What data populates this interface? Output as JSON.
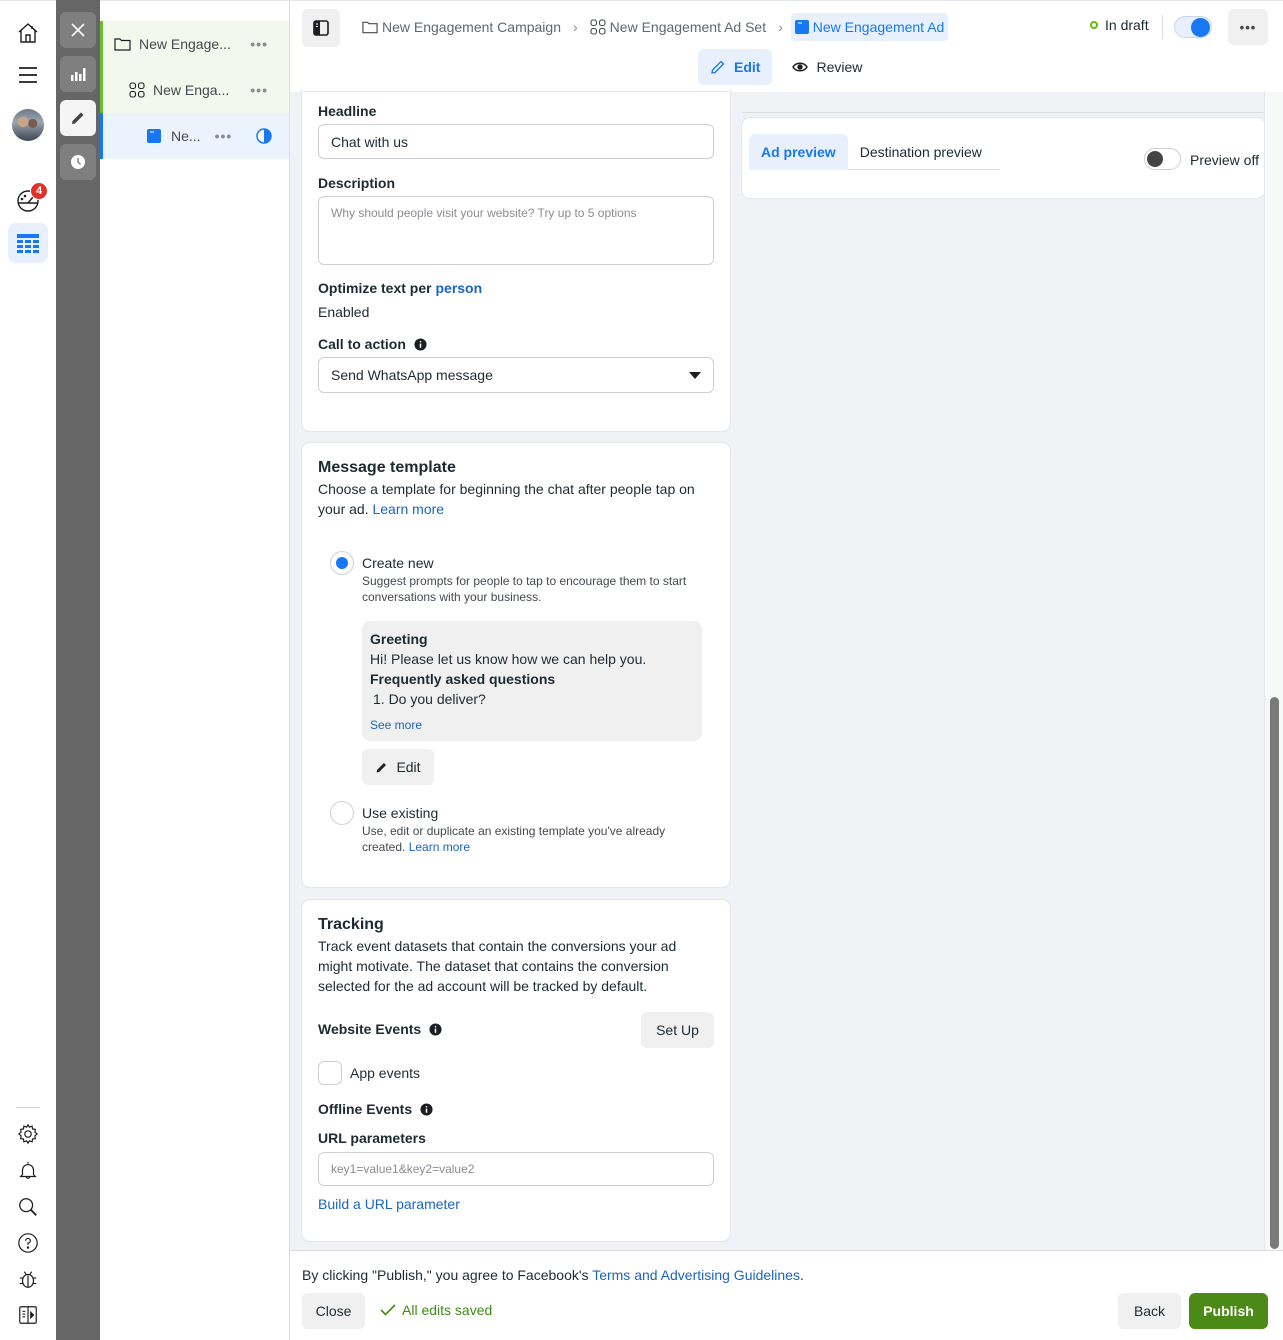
{
  "rail": {
    "icons": [
      "home-icon",
      "menu-icon",
      "avatar",
      "dashboard-icon",
      "ads-manager-icon",
      "settings-icon",
      "notifications-icon",
      "search-icon",
      "help-icon",
      "bug-icon",
      "side-panel-icon"
    ],
    "notification_count": "4"
  },
  "toolbar": {
    "icons": [
      "close-icon",
      "chart-icon",
      "edit-icon",
      "history-icon"
    ]
  },
  "tree": {
    "campaign": {
      "label": "New Engage...",
      "more": "•••"
    },
    "adset": {
      "label": "New Enga...",
      "more": "•••"
    },
    "ad": {
      "label": "Ne...",
      "more": "•••"
    }
  },
  "header": {
    "breadcrumbs": [
      {
        "label": "New Engagement Campaign",
        "icon": "folder-icon"
      },
      {
        "label": "New Engagement Ad Set",
        "icon": "grid-icon"
      },
      {
        "label": "New Engagement Ad",
        "icon": "ad-icon"
      }
    ],
    "status": "In draft",
    "toggle_on": true,
    "more": "•••",
    "tabs": [
      {
        "label": "Edit",
        "active": true
      },
      {
        "label": "Review",
        "active": false
      }
    ]
  },
  "ad_creative": {
    "headline_label": "Headline",
    "headline_value": "Chat with us",
    "description_label": "Description",
    "description_placeholder": "Why should people visit your website? Try up to 5 options",
    "optimize_label": "Optimize text per",
    "optimize_link": "person",
    "optimize_value": "Enabled",
    "cta_label": "Call to action",
    "cta_value": "Send WhatsApp message"
  },
  "message_template": {
    "title": "Message template",
    "description": "Choose a template for beginning the chat after people tap on your ad.",
    "learn_more": "Learn more",
    "options": [
      {
        "title": "Create new",
        "description": "Suggest prompts for people to tap to encourage them to start conversations with your business.",
        "selected": true
      },
      {
        "title": "Use existing",
        "description": "Use, edit or duplicate an existing template you've already created.",
        "learn_more": "Learn more",
        "selected": false
      }
    ],
    "greeting_label": "Greeting",
    "greeting_text": "Hi! Please let us know how we can help you.",
    "faq_label": "Frequently asked questions",
    "faq_items": [
      "1. Do you deliver?"
    ],
    "see_more": "See more",
    "edit_button": "Edit"
  },
  "tracking": {
    "title": "Tracking",
    "description": "Track event datasets that contain the conversions your ad might motivate. The dataset that contains the conversion selected for the ad account will be tracked by default.",
    "website_events_label": "Website Events",
    "setup_button": "Set Up",
    "app_events_label": "App events",
    "app_events_checked": false,
    "offline_events_label": "Offline Events",
    "url_params_label": "URL parameters",
    "url_params_placeholder": "key1=value1&key2=value2",
    "build_url_link": "Build a URL parameter"
  },
  "preview": {
    "tabs": [
      {
        "label": "Ad preview",
        "active": true
      },
      {
        "label": "Destination preview",
        "active": false
      }
    ],
    "toggle_label": "Preview off",
    "toggle_on": false
  },
  "footer": {
    "terms_prefix": "By clicking \"Publish,\" you agree to Facebook's",
    "terms_link": "Terms and Advertising Guidelines",
    "terms_suffix": ".",
    "close_button": "Close",
    "saved_status": "All edits saved",
    "back_button": "Back",
    "publish_button": "Publish"
  },
  "colors": {
    "accent_blue": "#1877f2",
    "link_blue": "#1a65c2",
    "publish_green": "#4b8a16",
    "saved_green": "#3f8a12",
    "draft_green": "#63be09",
    "badge_red": "#e0312b"
  }
}
